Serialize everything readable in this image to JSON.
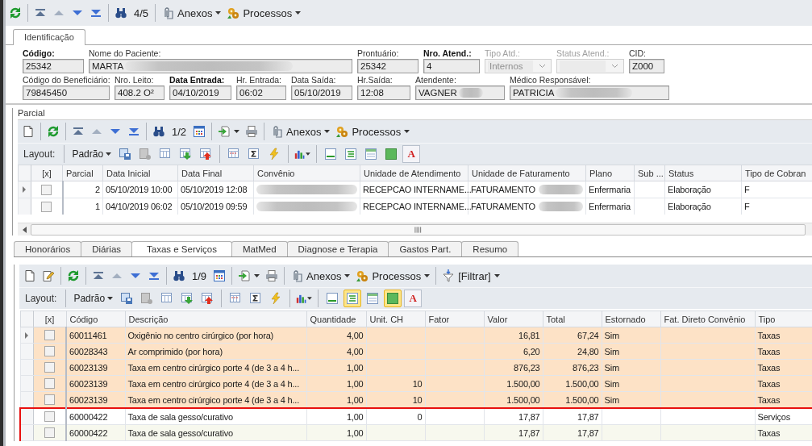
{
  "toolbar": [
    {
      "kind": "refresh"
    },
    {
      "kind": "separator"
    },
    {
      "kind": "first"
    },
    {
      "kind": "prev"
    },
    {
      "kind": "next"
    },
    {
      "kind": "last"
    },
    {
      "kind": "separator"
    },
    {
      "kind": "find"
    },
    {
      "kind": "counter",
      "text": "4/5"
    },
    {
      "kind": "separator"
    },
    {
      "kind": "attach",
      "text": "Anexos"
    },
    {
      "kind": "processes",
      "text": "Processos"
    }
  ],
  "tabs": [
    {
      "label": "Identificação",
      "selected": true
    }
  ],
  "identification": {
    "first_line": [
      {
        "label": "Código:",
        "value": "25342",
        "kind": "text",
        "bold": true,
        "disabled": false,
        "redacted": false
      },
      {
        "label": "Nome do Paciente:",
        "value": "MARTA",
        "kind": "text",
        "bold": false,
        "disabled": false,
        "redacted": true
      },
      {
        "label": "Prontuário:",
        "value": "25342",
        "kind": "text",
        "bold": false,
        "disabled": false,
        "redacted": false
      },
      {
        "label": "Nro. Atend.:",
        "value": "4",
        "kind": "text",
        "bold": true,
        "disabled": false,
        "redacted": false
      },
      {
        "label": "Tipo Atd.:",
        "value": "Internos",
        "kind": "combo",
        "bold": false,
        "disabled": true,
        "redacted": false
      },
      {
        "label": "Status Atend.:",
        "kind": "combo",
        "bold": false,
        "disabled": true,
        "redacted": false
      },
      {
        "label": "CID:",
        "value": "Z000",
        "kind": "text",
        "bold": false,
        "disabled": false,
        "redacted": false
      }
    ],
    "second_line": [
      {
        "label": "Código do Beneficiário:",
        "value": "79845450",
        "kind": "text",
        "bold": false,
        "disabled": false,
        "redacted": false
      },
      {
        "label": "Nro. Leito:",
        "value": "408.2 O²",
        "kind": "text",
        "bold": false,
        "disabled": false,
        "redacted": false
      },
      {
        "label": "Data Entrada:",
        "value": "04/10/2019",
        "kind": "text",
        "bold": true,
        "disabled": false,
        "redacted": false
      },
      {
        "label": "Hr. Entrada:",
        "value": "06:02",
        "kind": "text",
        "bold": false,
        "disabled": false,
        "redacted": false
      },
      {
        "label": "Data Saída:",
        "value": "05/10/2019",
        "kind": "text",
        "bold": false,
        "disabled": false,
        "redacted": false
      },
      {
        "label": "Hr.Saída:",
        "value": "12:08",
        "kind": "text",
        "bold": false,
        "disabled": false,
        "redacted": false
      },
      {
        "label": "Atendente:",
        "value": "VAGNER",
        "kind": "text",
        "bold": false,
        "disabled": false,
        "redacted": true
      },
      {
        "label": "Médico Responsável:",
        "value": "PATRICIA",
        "kind": "text",
        "bold": false,
        "disabled": false,
        "redacted": true
      }
    ]
  },
  "parcial": {
    "title": "Parcial",
    "toolbar": [
      {
        "kind": "new"
      },
      {
        "kind": "separator"
      },
      {
        "kind": "refresh"
      },
      {
        "kind": "separator"
      },
      {
        "kind": "first"
      },
      {
        "kind": "prev"
      },
      {
        "kind": "next"
      },
      {
        "kind": "last"
      },
      {
        "kind": "separator"
      },
      {
        "kind": "find"
      },
      {
        "kind": "counter",
        "text": "1/2"
      },
      {
        "kind": "grid"
      },
      {
        "kind": "separator"
      },
      {
        "kind": "export"
      },
      {
        "kind": "print"
      },
      {
        "kind": "separator"
      },
      {
        "kind": "attach",
        "text": "Anexos"
      },
      {
        "kind": "processes",
        "text": "Processos"
      }
    ],
    "layout_bar": {
      "label": "Layout:",
      "preset": "Padrão",
      "buttons": [
        {
          "kind": "save",
          "on": false
        },
        {
          "kind": "disabled",
          "on": false
        },
        {
          "kind": "columns",
          "on": false
        },
        {
          "kind": "import",
          "on": false
        },
        {
          "kind": "export",
          "on": false
        },
        {
          "kind": "separator"
        },
        {
          "kind": "filterrow",
          "on": false
        },
        {
          "kind": "sigma",
          "on": false
        },
        {
          "kind": "lightning",
          "on": false
        },
        {
          "kind": "separator"
        },
        {
          "kind": "chart",
          "on": false
        },
        {
          "kind": "separator"
        },
        {
          "kind": "footer",
          "on": false
        },
        {
          "kind": "group",
          "on": false
        },
        {
          "kind": "header",
          "on": false
        },
        {
          "kind": "fill",
          "on": false
        },
        {
          "kind": "font",
          "text": "A",
          "on": false
        }
      ]
    },
    "grid": {
      "checkbox_column": "[x]",
      "columns": [
        "Parcial",
        "Data Inicial",
        "Data Final",
        "Convênio",
        "Unidade de Atendimento",
        "Unidade de Faturamento",
        "Plano",
        "Sub ...",
        "Status",
        "Tipo de Cobran"
      ],
      "rows": [
        {
          "current": true,
          "checked": false,
          "cells": [
            "2",
            "05/10/2019 10:00",
            "05/10/2019 12:08",
            {
              "redacted": true
            },
            "RECEPCAO INTERNAME...",
            {
              "text": "FATURAMENTO",
              "redacted": true
            },
            "Enfermaria",
            null,
            "Elaboração",
            "F"
          ]
        },
        {
          "current": false,
          "checked": false,
          "cells": [
            "1",
            "04/10/2019 06:02",
            "05/10/2019 09:59",
            {
              "redacted": true
            },
            "RECEPCAO INTERNAME...",
            {
              "text": "FATURAMENTO",
              "redacted": true
            },
            "Enfermaria",
            null,
            "Elaboração",
            "F"
          ]
        }
      ]
    }
  },
  "detail_tabs": [
    {
      "label": "Honorários",
      "selected": false
    },
    {
      "label": "Diárias",
      "selected": false
    },
    {
      "label": "Taxas e Serviços",
      "selected": true
    },
    {
      "label": "MatMed",
      "selected": false
    },
    {
      "label": "Diagnose e Terapia",
      "selected": false
    },
    {
      "label": "Gastos Part.",
      "selected": false
    },
    {
      "label": "Resumo",
      "selected": false
    }
  ],
  "items": {
    "toolbar": [
      {
        "kind": "new"
      },
      {
        "kind": "edit"
      },
      {
        "kind": "separator"
      },
      {
        "kind": "refresh"
      },
      {
        "kind": "separator"
      },
      {
        "kind": "first"
      },
      {
        "kind": "prev"
      },
      {
        "kind": "next"
      },
      {
        "kind": "last"
      },
      {
        "kind": "separator"
      },
      {
        "kind": "find"
      },
      {
        "kind": "counter",
        "text": "1/9"
      },
      {
        "kind": "grid"
      },
      {
        "kind": "separator"
      },
      {
        "kind": "export"
      },
      {
        "kind": "print"
      },
      {
        "kind": "separator"
      },
      {
        "kind": "attach",
        "text": "Anexos"
      },
      {
        "kind": "processes",
        "text": "Processos"
      },
      {
        "kind": "separator"
      },
      {
        "kind": "filter",
        "text": "[Filtrar]"
      }
    ],
    "layout_bar": {
      "label": "Layout:",
      "preset": "Padrão",
      "buttons": [
        {
          "kind": "save",
          "on": false
        },
        {
          "kind": "disabled",
          "on": false
        },
        {
          "kind": "columns",
          "on": false
        },
        {
          "kind": "import",
          "on": false
        },
        {
          "kind": "export",
          "on": false
        },
        {
          "kind": "separator"
        },
        {
          "kind": "filterrow",
          "on": false
        },
        {
          "kind": "sigma",
          "on": false
        },
        {
          "kind": "lightning",
          "on": false
        },
        {
          "kind": "separator"
        },
        {
          "kind": "chart",
          "on": false
        },
        {
          "kind": "separator"
        },
        {
          "kind": "footer",
          "on": false
        },
        {
          "kind": "group",
          "on": true
        },
        {
          "kind": "header",
          "on": false
        },
        {
          "kind": "fill",
          "on": true
        },
        {
          "kind": "font",
          "text": "A",
          "on": false
        }
      ]
    },
    "grid": {
      "checkbox_column": "[x]",
      "columns": [
        "Código",
        "Descrição",
        "Quantidade",
        "Unit. CH",
        "Fator",
        "Valor",
        "Total",
        "Estornado",
        "Fat. Direto Convênio",
        "Tipo"
      ],
      "rows": [
        {
          "current": true,
          "checked": false,
          "color": "#fde2c6",
          "boxed": false,
          "cells": [
            "60011461",
            "Oxigênio no centro cirúrgico (por hora)",
            "4,00",
            null,
            null,
            "16,81",
            "67,24",
            "Sim",
            null,
            "Taxas"
          ]
        },
        {
          "current": false,
          "checked": false,
          "color": "#fde2c6",
          "boxed": false,
          "cells": [
            "60028343",
            "Ar comprimido (por hora)",
            "4,00",
            null,
            null,
            "6,20",
            "24,80",
            "Sim",
            null,
            "Taxas"
          ]
        },
        {
          "current": false,
          "checked": false,
          "color": "#fde2c6",
          "boxed": false,
          "cells": [
            "60023139",
            "Taxa em centro cirúrgico porte 4 (de 3 a 4 h...",
            "1,00",
            null,
            null,
            "876,23",
            "876,23",
            "Sim",
            null,
            "Taxas"
          ]
        },
        {
          "current": false,
          "checked": false,
          "color": "#fde2c6",
          "boxed": false,
          "cells": [
            "60023139",
            "Taxa em centro cirúrgico porte 4 (de 3 a 4 h...",
            "1,00",
            "10",
            null,
            "1.500,00",
            "1.500,00",
            "Sim",
            null,
            "Taxas"
          ]
        },
        {
          "current": false,
          "checked": false,
          "color": "#fde2c6",
          "boxed": false,
          "cells": [
            "60023139",
            "Taxa em centro cirúrgico porte 4 (de 3 a 4 h...",
            "1,00",
            "10",
            null,
            "1.500,00",
            "1.500,00",
            "Sim",
            null,
            "Taxas"
          ]
        },
        {
          "current": false,
          "checked": false,
          "color": "#ffffff",
          "boxed": true,
          "cells": [
            "60000422",
            "Taxa de sala gesso/curativo",
            "1,00",
            "0",
            null,
            "17,87",
            "17,87",
            null,
            null,
            "Serviços"
          ]
        },
        {
          "current": false,
          "checked": false,
          "color": "#f7f8ee",
          "boxed": true,
          "cells": [
            "60000422",
            "Taxa de sala gesso/curativo",
            "1,00",
            null,
            null,
            "17,87",
            "17,87",
            null,
            null,
            "Taxas"
          ]
        }
      ]
    }
  }
}
